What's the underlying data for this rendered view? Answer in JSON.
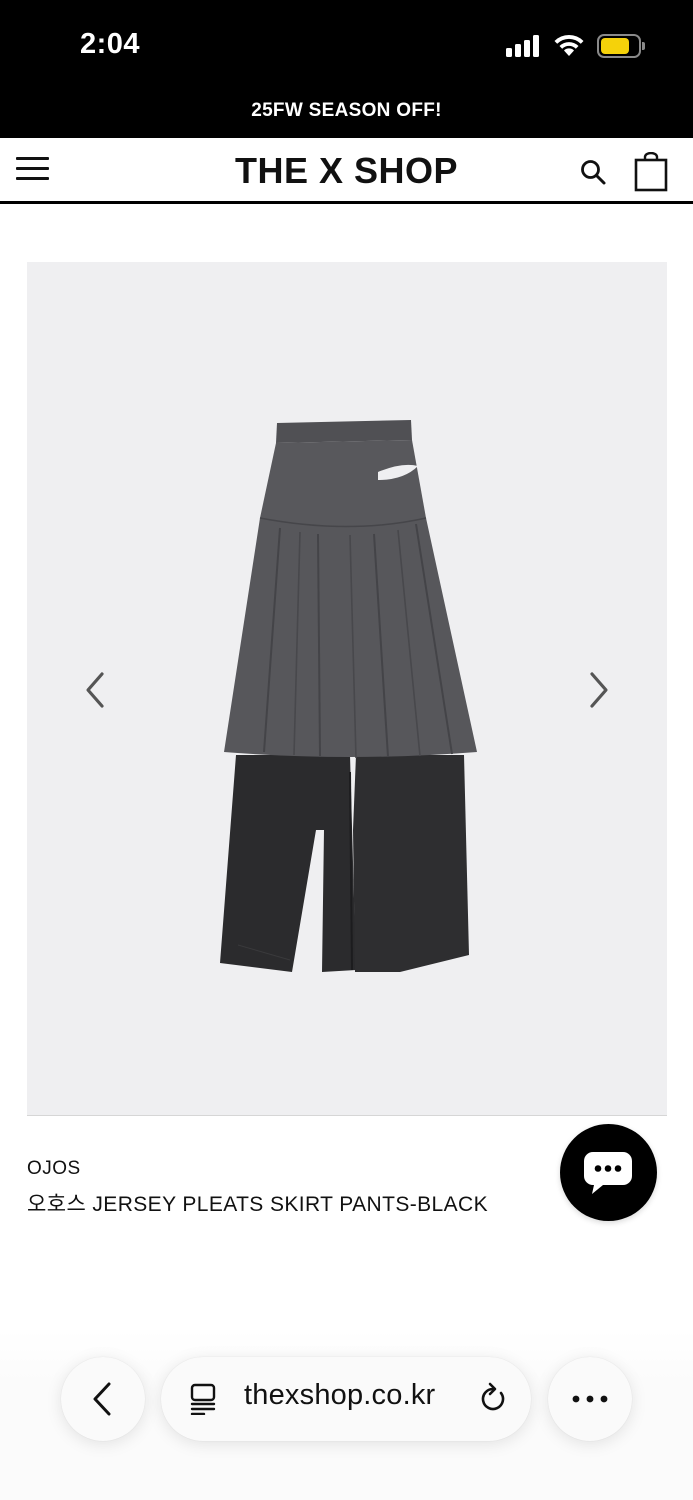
{
  "status_bar": {
    "time": "2:04",
    "battery_color": "#f5d20a"
  },
  "promo": {
    "text": "25FW SEASON OFF!"
  },
  "header": {
    "title": "THE X SHOP"
  },
  "gallery": {
    "background": "#efeff1"
  },
  "product": {
    "brand": "OJOS",
    "name": "오호스 JERSEY PLEATS SKIRT PANTS-BLACK"
  },
  "browser": {
    "url": "thexshop.co.kr"
  },
  "icons": [
    "menu-icon",
    "search-icon",
    "bag-icon",
    "chevron-left-icon",
    "chevron-right-icon",
    "chat-icon",
    "back-icon",
    "reader-icon",
    "reload-icon",
    "more-icon"
  ]
}
